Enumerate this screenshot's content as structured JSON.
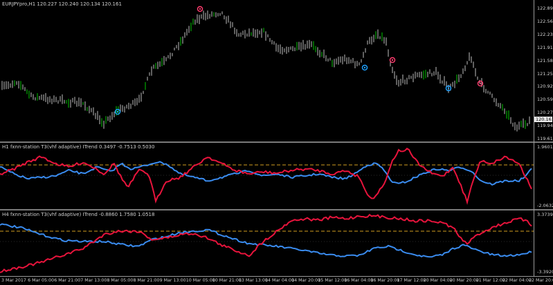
{
  "main": {
    "title": "EURJPYpro,H1  120.227 120.240 120.134 120.161",
    "price_ticks": [
      "122.895",
      "122.565",
      "122.235",
      "121.910",
      "121.580",
      "121.255",
      "120.925",
      "120.595",
      "120.270",
      "119.940",
      "119.610"
    ],
    "current_price": "120.161",
    "ylim": [
      119.61,
      122.895
    ],
    "colors": {
      "up": "#00c800",
      "down": "#c0c0c0",
      "sell_marker": "#ff3c6e",
      "buy_marker": "#1ea0ff"
    }
  },
  "ind1": {
    "title": "H1  fxnn-station T3(vhf adaptive) ITrend  0.3497 -0.7513 0.5030",
    "top": "1.9601",
    "bottom": "-2.0632",
    "colors": {
      "red": "#e8143c",
      "blue": "#3a8cf0",
      "level": "#d4a020"
    }
  },
  "ind2": {
    "title": "H4  fxnn-station T3(vhf adaptive) ITrend  -0.8860 1.7580 1.0518",
    "top": "3.3739",
    "bottom": "-3.3920",
    "colors": {
      "red": "#e8143c",
      "blue": "#3a8cf0",
      "level": "#d4a020"
    }
  },
  "xaxis": [
    "3 Mar 2017",
    "6 Mar 05:00",
    "6 Mar 21:00",
    "7 Mar 13:00",
    "8 Mar 05:00",
    "8 Mar 21:00",
    "9 Mar 13:00",
    "10 Mar 05:00",
    "10 Mar 21:00",
    "13 Mar 13:00",
    "14 Mar 04:00",
    "14 Mar 20:00",
    "15 Mar 12:00",
    "16 Mar 04:00",
    "16 Mar 20:00",
    "17 Mar 12:00",
    "20 Mar 04:00",
    "20 Mar 20:00",
    "21 Mar 12:00",
    "22 Mar 04:00",
    "22 Mar 20:00"
  ]
}
